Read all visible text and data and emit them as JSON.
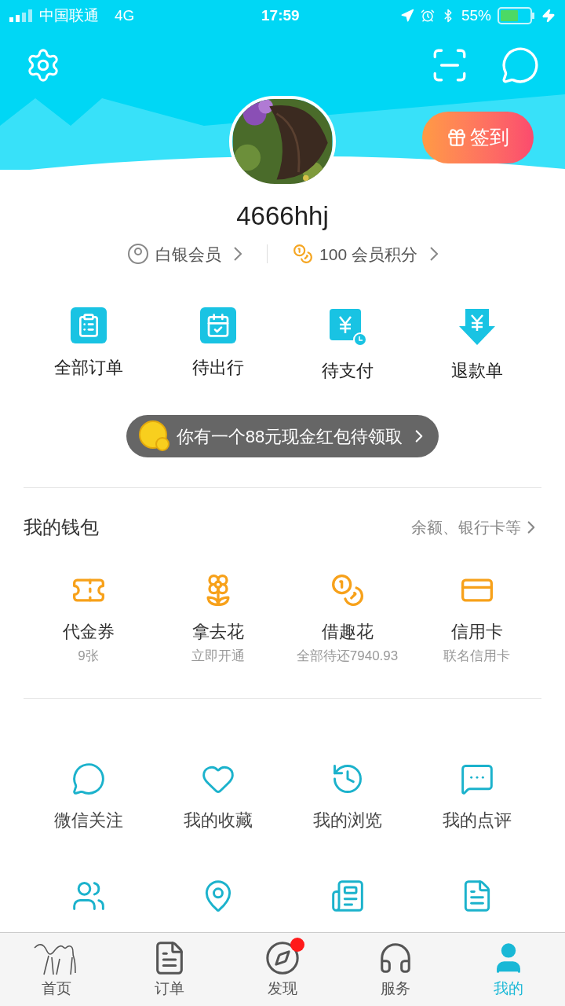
{
  "status_bar": {
    "carrier": "中国联通",
    "network": "4G",
    "time": "17:59",
    "battery": "55%"
  },
  "profile": {
    "sign_in": "签到",
    "username": "4666hhj",
    "membership": "白银会员",
    "points": "100 会员积分"
  },
  "orders": [
    {
      "label": "全部订单"
    },
    {
      "label": "待出行"
    },
    {
      "label": "待支付"
    },
    {
      "label": "退款单"
    }
  ],
  "promo": "你有一个88元现金红包待领取",
  "wallet": {
    "title": "我的钱包",
    "link": "余额、银行卡等",
    "items": [
      {
        "label": "代金券",
        "sub": "9张"
      },
      {
        "label": "拿去花",
        "sub": "立即开通"
      },
      {
        "label": "借趣花",
        "sub": "全部待还7940.93"
      },
      {
        "label": "信用卡",
        "sub": "联名信用卡"
      }
    ]
  },
  "services": [
    {
      "label": "微信关注"
    },
    {
      "label": "我的收藏"
    },
    {
      "label": "我的浏览"
    },
    {
      "label": "我的点评"
    }
  ],
  "tab_bar": [
    {
      "label": "首页",
      "selected": false,
      "dot": false
    },
    {
      "label": "订单",
      "selected": false,
      "dot": false
    },
    {
      "label": "发现",
      "selected": false,
      "dot": true
    },
    {
      "label": "服务",
      "selected": false,
      "dot": false
    },
    {
      "label": "我的",
      "selected": true,
      "dot": false
    }
  ]
}
